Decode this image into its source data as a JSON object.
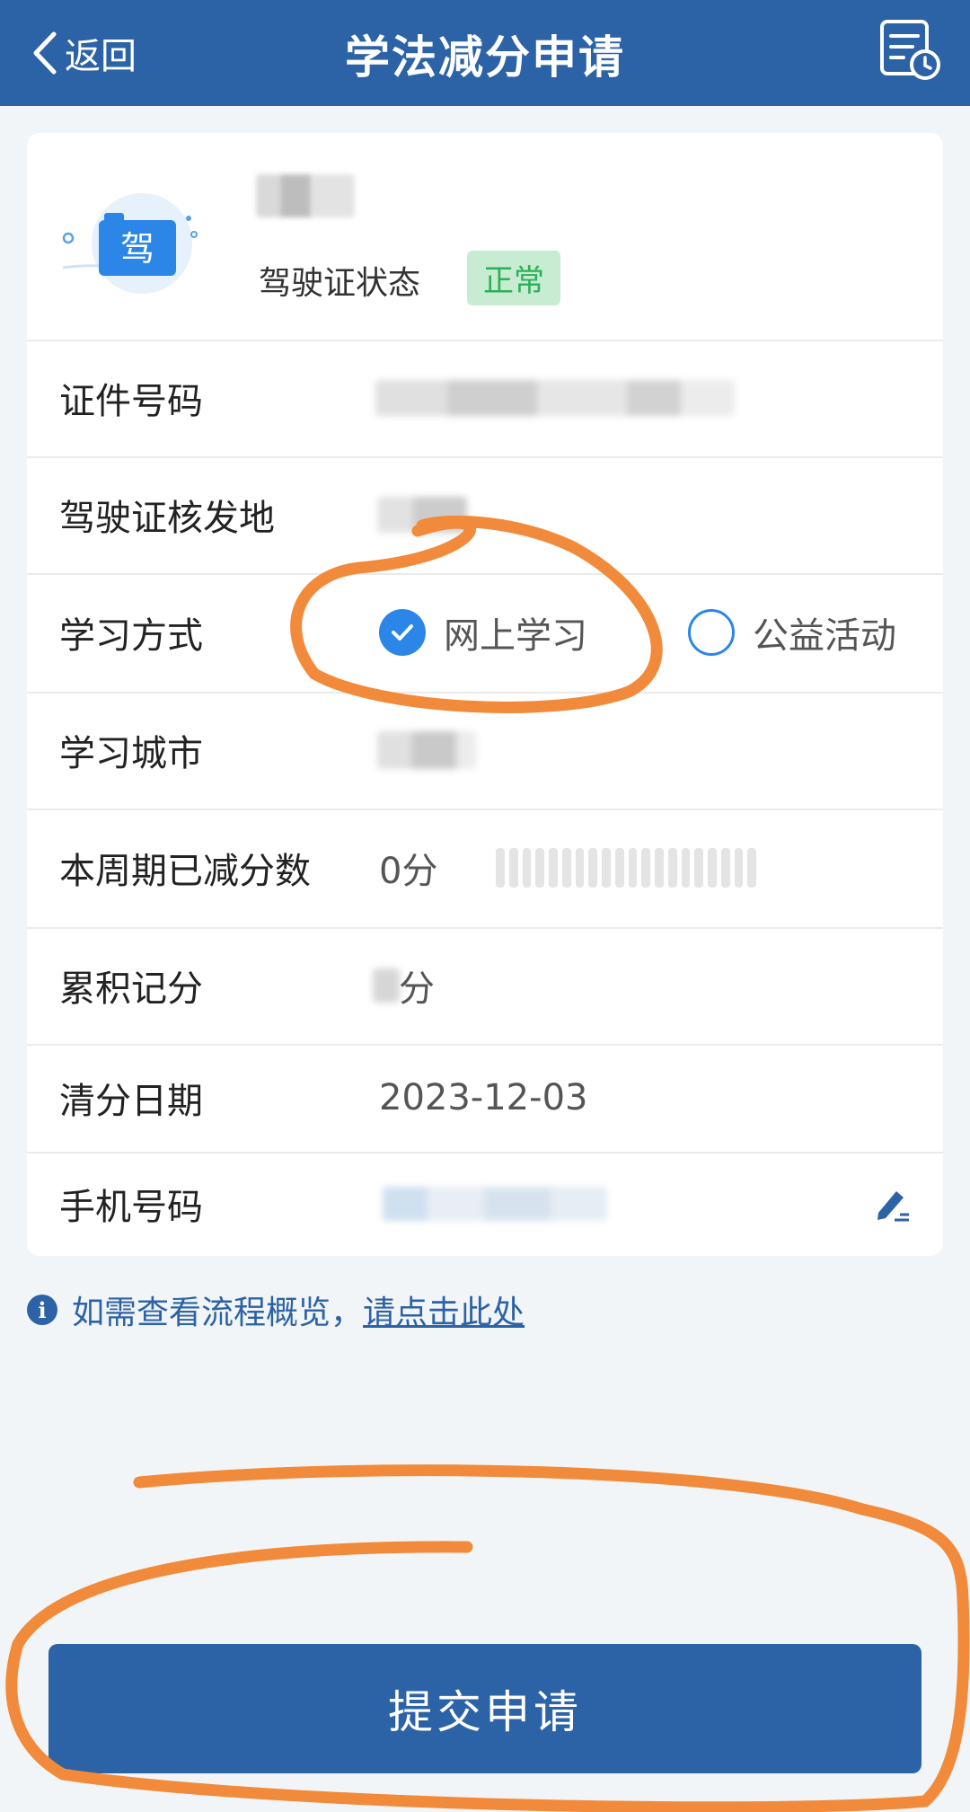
{
  "header": {
    "back_label": "返回",
    "title": "学法减分申请",
    "record_icon": "document-clock-icon"
  },
  "profile": {
    "avatar_badge": "驾",
    "status_label": "驾驶证状态",
    "status_value": "正常",
    "status_color": "#2bb155"
  },
  "fields": {
    "id_number_label": "证件号码",
    "issue_place_label": "驾驶证核发地",
    "study_mode_label": "学习方式",
    "study_modes": [
      {
        "label": "网上学习",
        "selected": true
      },
      {
        "label": "公益活动",
        "selected": false
      }
    ],
    "study_city_label": "学习城市",
    "deducted_label": "本周期已减分数",
    "deducted_value": "0分",
    "deducted_progress": 0,
    "accumulated_label": "累积记分",
    "accumulated_suffix": "分",
    "clear_date_label": "清分日期",
    "clear_date_value": "2023-12-03",
    "phone_label": "手机号码"
  },
  "info": {
    "text": "如需查看流程概览，",
    "link": "请点击此处"
  },
  "submit": {
    "label": "提交申请"
  },
  "colors": {
    "primary": "#2c62a6",
    "accent": "#2b86e8",
    "annotation": "#f28a3b"
  }
}
